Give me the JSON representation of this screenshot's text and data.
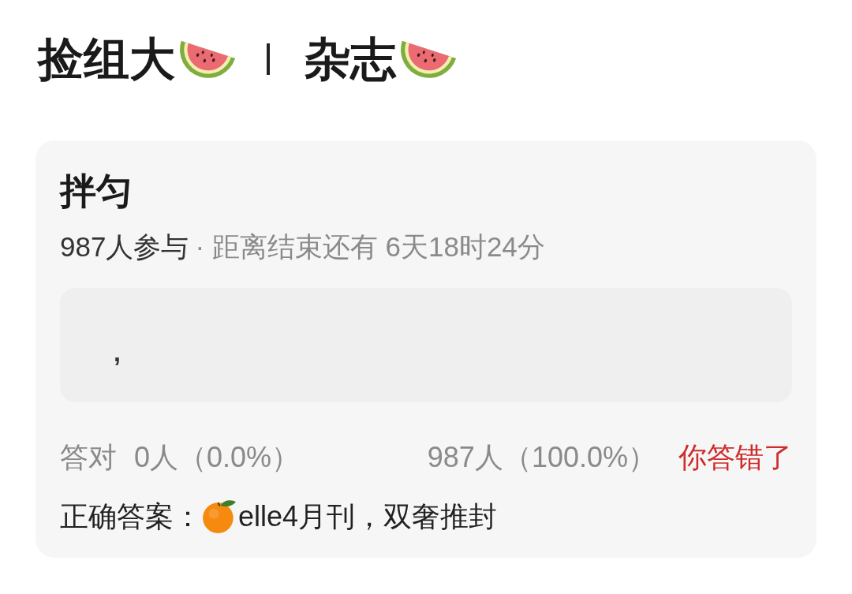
{
  "header": {
    "segments": [
      "捡组大",
      "杂志"
    ]
  },
  "poll": {
    "question": "拌匀",
    "participants": "987人参与",
    "deadline": "· 距离结束还有 6天18时24分",
    "answer": ",",
    "stats": {
      "correct_label": "答对",
      "correct_count": "0人（0.0%）",
      "wrong_count": "987人（100.0%）",
      "result": {
        "text": "你答错了",
        "correct": false
      }
    },
    "correct_answer": {
      "label": "正确答案：",
      "text": "elle4月刊，双奢推封"
    }
  }
}
